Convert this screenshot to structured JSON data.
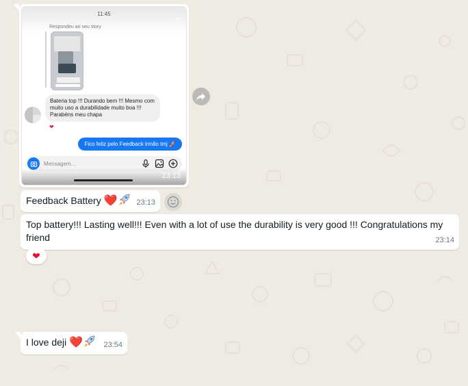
{
  "screenshot_message": {
    "story_time": "11:45",
    "reply_label": "Respondeu ao seu story",
    "incoming_text": "Bateria top !!! Durando bem !!! Mesmo com muito uso a durabilidade muito boa !!! Parabéns meu chapa",
    "reaction": "❤",
    "outgoing_text": "Fico feliz pelo Feedback irmão tmj 🚀",
    "composer_placeholder": "Mensagem...",
    "timestamp": "23:13"
  },
  "messages": [
    {
      "text": "Feedback Battery",
      "emoji": "❤️",
      "time": "23:13"
    },
    {
      "text": "Top battery!!!  Lasting well!!!  Even with a lot of use the durability is very good !!!  Congratulations my friend",
      "time": "23:14",
      "reaction": "❤"
    },
    {
      "text": "I love deji",
      "emoji": "❤️",
      "time": "23:54"
    }
  ],
  "colors": {
    "chat_background": "#efeae2",
    "bubble_incoming": "#ffffff",
    "instagram_blue": "#1877f2",
    "heart_red": "#e8112d"
  },
  "icons": {
    "forward": "forward-arrow-icon",
    "react": "emoji-smile-icon",
    "camera": "camera-icon",
    "mic": "microphone-icon",
    "gallery": "image-icon",
    "add": "plus-circle-icon"
  }
}
